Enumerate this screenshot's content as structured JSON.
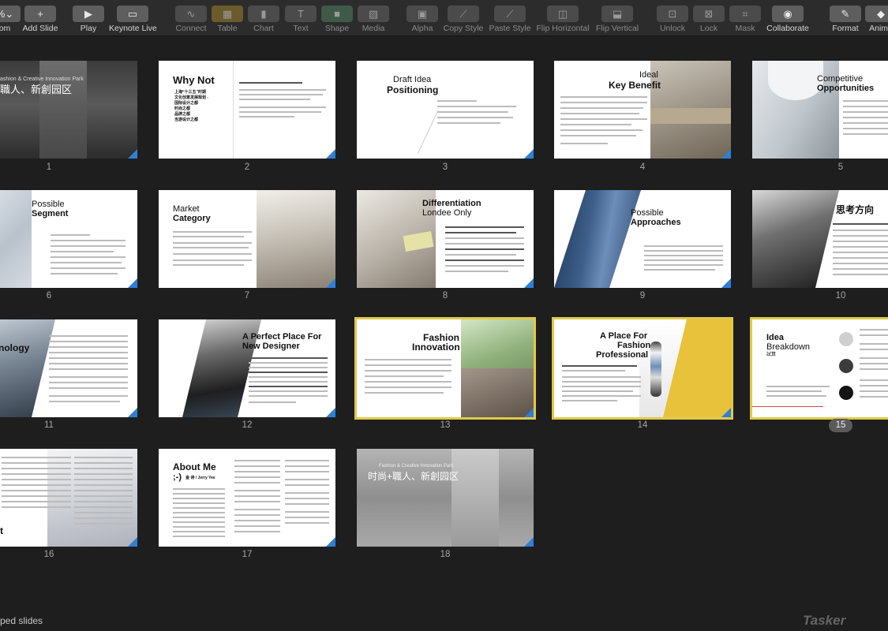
{
  "toolbar": {
    "items": [
      {
        "label": "om",
        "glyph": "%⌄"
      },
      {
        "label": "Add Slide",
        "glyph": "+"
      },
      {
        "label": "Play",
        "glyph": "▶"
      },
      {
        "label": "Keynote Live",
        "glyph": "▭"
      },
      {
        "label": "Connect",
        "glyph": "∿"
      },
      {
        "label": "Table",
        "glyph": "▦"
      },
      {
        "label": "Chart",
        "glyph": "▮"
      },
      {
        "label": "Text",
        "glyph": "T"
      },
      {
        "label": "Shape",
        "glyph": "■"
      },
      {
        "label": "Media",
        "glyph": "▨"
      },
      {
        "label": "Alpha",
        "glyph": "▣"
      },
      {
        "label": "Copy Style",
        "glyph": "⟋"
      },
      {
        "label": "Paste Style",
        "glyph": "⟋"
      },
      {
        "label": "Flip Horizontal",
        "glyph": "◫"
      },
      {
        "label": "Flip Vertical",
        "glyph": "⬓"
      },
      {
        "label": "Unlock",
        "glyph": "⊡"
      },
      {
        "label": "Lock",
        "glyph": "⊠"
      },
      {
        "label": "Mask",
        "glyph": "⌗"
      },
      {
        "label": "Collaborate",
        "glyph": "◉"
      },
      {
        "label": "Format",
        "glyph": "✎"
      },
      {
        "label": "Anima",
        "glyph": "◆"
      }
    ]
  },
  "slides": [
    {
      "number": "1",
      "title": "",
      "title2": "職人、新創园区",
      "sub": "ashion & Creative Innovation Park"
    },
    {
      "number": "2",
      "title": "Why Not",
      "title2": ""
    },
    {
      "number": "3",
      "title": "Draft Idea",
      "title2": "Positioning"
    },
    {
      "number": "4",
      "title": "Ideal",
      "title2": "Key Benefit"
    },
    {
      "number": "5",
      "title": "Competitive",
      "title2": "Opportunities"
    },
    {
      "number": "6",
      "title": "Possible",
      "title2": "Segment"
    },
    {
      "number": "7",
      "title": "Market",
      "title2": "Category"
    },
    {
      "number": "8",
      "title": "Differentiation",
      "title2": "Londee Only"
    },
    {
      "number": "9",
      "title": "Possible",
      "title2": "Approaches"
    },
    {
      "number": "10",
      "title": "思考方向",
      "title2": ""
    },
    {
      "number": "11",
      "title": "nology",
      "title2": ""
    },
    {
      "number": "12",
      "title": "A Perfect Place For",
      "title2": "New Designer"
    },
    {
      "number": "13",
      "title": "Fashion",
      "title2": "Innovation"
    },
    {
      "number": "14",
      "title": "A Place For",
      "title2": "Fashion",
      "title3": "Professional"
    },
    {
      "number": "15",
      "title": "Idea",
      "title2": "Breakdown",
      "title3": "試算"
    },
    {
      "number": "16",
      "title": "t",
      "title2": ""
    },
    {
      "number": "17",
      "title": "About Me",
      "title2": ";-)",
      "sub": "金 诗 / Jerry Yee"
    },
    {
      "number": "18",
      "title": "时尚+職人、新創园区",
      "title2": "",
      "sub": "Fashion & Creative Innovation Park"
    }
  ],
  "slide2_bullets": [
    "上海“十三五”时期",
    "文化创意发展规划 -",
    "国际设计之都",
    "时尚之都",
    "品牌之都",
    "当游设计之都"
  ],
  "statusbar": {
    "text": "ped slides",
    "logo": "Tasker"
  },
  "colors": {
    "accent_corner": "#2f7fd8",
    "selection": "#e0c94a"
  }
}
